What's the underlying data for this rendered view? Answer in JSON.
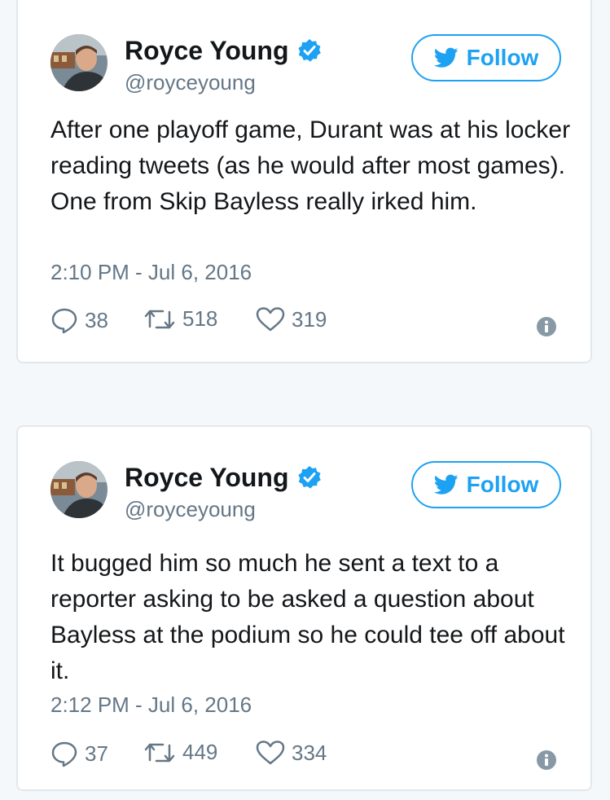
{
  "tweets": [
    {
      "author": {
        "name": "Royce Young",
        "handle": "@royceyoung",
        "verified": true
      },
      "follow_label": "Follow",
      "text": "After one playoff game, Durant was at his locker reading tweets (as he would after most games). One from Skip Bayless really irked him.",
      "timestamp": "2:10 PM - Jul 6, 2016",
      "stats": {
        "replies": "38",
        "retweets": "518",
        "likes": "319"
      }
    },
    {
      "author": {
        "name": "Royce Young",
        "handle": "@royceyoung",
        "verified": true
      },
      "follow_label": "Follow",
      "text": "It bugged him so much he sent a text to a reporter asking to be asked a question about Bayless at the podium so he could tee off about it.",
      "timestamp": "2:12 PM - Jul 6, 2016",
      "stats": {
        "replies": "37",
        "retweets": "449",
        "likes": "334"
      }
    }
  ],
  "icons": {
    "verified": "verified-badge-icon",
    "bird": "twitter-bird-icon",
    "reply": "reply-icon",
    "retweet": "retweet-icon",
    "like": "heart-icon",
    "info": "info-icon"
  },
  "colors": {
    "accent": "#1da1f2",
    "muted": "#657786",
    "text": "#14171a",
    "border": "#e1e8ed",
    "background": "#f5f8fa"
  }
}
